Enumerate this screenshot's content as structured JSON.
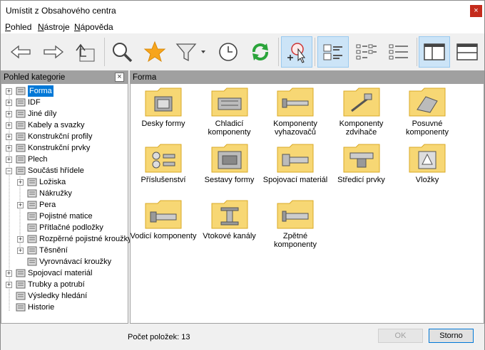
{
  "window": {
    "title": "Umístit z Obsahového centra",
    "close": "×"
  },
  "menu": [
    {
      "label": "Pohled",
      "key": "P",
      "rest": "ohled"
    },
    {
      "label": "Nástroje",
      "key": "N",
      "rest": "ástroje"
    },
    {
      "label": "Nápověda",
      "key": "N",
      "rest": "ápověda"
    }
  ],
  "toolbar": [
    {
      "name": "back-button",
      "icon": "arrow-left-icon"
    },
    {
      "name": "forward-button",
      "icon": "arrow-right-icon"
    },
    {
      "name": "up-level-button",
      "icon": "up-folder-icon"
    },
    {
      "name": "search-button",
      "icon": "magnifier-icon"
    },
    {
      "name": "favorites-button",
      "icon": "star-icon"
    },
    {
      "name": "filter-button",
      "icon": "funnel-icon"
    },
    {
      "name": "history-button",
      "icon": "clock-icon"
    },
    {
      "name": "refresh-button",
      "icon": "refresh-icon"
    },
    {
      "name": "autodrop-button",
      "icon": "autodrop-icon",
      "active": true
    },
    {
      "name": "view-large-icons-button",
      "icon": "large-icons-view-icon",
      "active": true
    },
    {
      "name": "view-list-button",
      "icon": "list-view-icon"
    },
    {
      "name": "view-details-button",
      "icon": "details-view-icon"
    },
    {
      "name": "layout-split-vertical-button",
      "icon": "split-vertical-icon",
      "active": true
    },
    {
      "name": "layout-split-horizontal-button",
      "icon": "split-horizontal-icon"
    }
  ],
  "left_panel": {
    "title": "Pohled kategorie",
    "close": "×",
    "tree": [
      {
        "label": "Forma",
        "level": 0,
        "exp": "+",
        "selected": true
      },
      {
        "label": "IDF",
        "level": 0,
        "exp": "+"
      },
      {
        "label": "Jiné díly",
        "level": 0,
        "exp": "+"
      },
      {
        "label": "Kabely a svazky",
        "level": 0,
        "exp": "+"
      },
      {
        "label": "Konstrukční profily",
        "level": 0,
        "exp": "+"
      },
      {
        "label": "Konstrukční prvky",
        "level": 0,
        "exp": "+"
      },
      {
        "label": "Plech",
        "level": 0,
        "exp": "+"
      },
      {
        "label": "Součásti hřídele",
        "level": 0,
        "exp": "-"
      },
      {
        "label": "Ložiska",
        "level": 1,
        "exp": "+"
      },
      {
        "label": "Nákružky",
        "level": 1,
        "exp": ""
      },
      {
        "label": "Pera",
        "level": 1,
        "exp": "+"
      },
      {
        "label": "Pojistné matice",
        "level": 1,
        "exp": ""
      },
      {
        "label": "Přítlačné podložky",
        "level": 1,
        "exp": ""
      },
      {
        "label": "Rozpěrné pojistné kroužky",
        "level": 1,
        "exp": "+"
      },
      {
        "label": "Těsnění",
        "level": 1,
        "exp": "+"
      },
      {
        "label": "Vyrovnávací kroužky",
        "level": 1,
        "exp": ""
      },
      {
        "label": "Spojovací materiál",
        "level": 0,
        "exp": "+"
      },
      {
        "label": "Trubky a potrubí",
        "level": 0,
        "exp": "+"
      },
      {
        "label": "Výsledky hledání",
        "level": 0,
        "exp": ""
      },
      {
        "label": "Historie",
        "level": 0,
        "exp": ""
      }
    ]
  },
  "right_panel": {
    "title": "Forma",
    "items": [
      {
        "label": "Desky formy"
      },
      {
        "label": "Chladicí komponenty"
      },
      {
        "label": "Komponenty vyhazovačů"
      },
      {
        "label": "Komponenty zdvihače"
      },
      {
        "label": "Posuvné komponenty"
      },
      {
        "label": "Příslušenství"
      },
      {
        "label": "Sestavy formy"
      },
      {
        "label": "Spojovací materiál"
      },
      {
        "label": "Středicí prvky"
      },
      {
        "label": "Vložky"
      },
      {
        "label": "Vodicí komponenty"
      },
      {
        "label": "Vtokové kanály"
      },
      {
        "label": "Zpětné komponenty"
      }
    ]
  },
  "status": {
    "count_text": "Počet položek: 13",
    "ok_label": "OK",
    "cancel_label": "Storno"
  },
  "colors": {
    "accent": "#0078d7",
    "folder": "#f7d774",
    "folder_edge": "#d9a826",
    "active_btn": "#cce4f7"
  }
}
